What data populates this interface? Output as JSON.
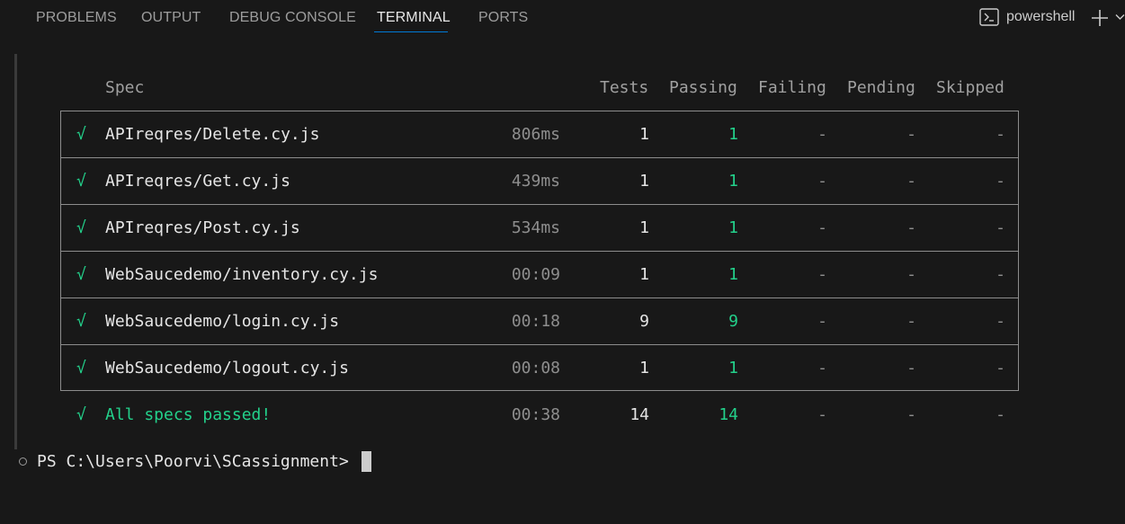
{
  "tabs": [
    {
      "label": "PROBLEMS",
      "active": false
    },
    {
      "label": "OUTPUT",
      "active": false
    },
    {
      "label": "DEBUG CONSOLE",
      "active": false
    },
    {
      "label": "TERMINAL",
      "active": true
    },
    {
      "label": "PORTS",
      "active": false
    }
  ],
  "shell": {
    "label": "powershell",
    "icon": "terminal-icon",
    "add_icon": "plus-icon",
    "dropdown_icon": "chevron-down-icon"
  },
  "headers": {
    "spec": "Spec",
    "tests": "Tests",
    "passing": "Passing",
    "failing": "Failing",
    "pending": "Pending",
    "skipped": "Skipped"
  },
  "rows": [
    {
      "check": "√",
      "spec": "APIreqres/Delete.cy.js",
      "duration": "806ms",
      "tests": "1",
      "passing": "1",
      "failing": "-",
      "pending": "-",
      "skipped": "-"
    },
    {
      "check": "√",
      "spec": "APIreqres/Get.cy.js",
      "duration": "439ms",
      "tests": "1",
      "passing": "1",
      "failing": "-",
      "pending": "-",
      "skipped": "-"
    },
    {
      "check": "√",
      "spec": "APIreqres/Post.cy.js",
      "duration": "534ms",
      "tests": "1",
      "passing": "1",
      "failing": "-",
      "pending": "-",
      "skipped": "-"
    },
    {
      "check": "√",
      "spec": "WebSaucedemo/inventory.cy.js",
      "duration": "00:09",
      "tests": "1",
      "passing": "1",
      "failing": "-",
      "pending": "-",
      "skipped": "-"
    },
    {
      "check": "√",
      "spec": "WebSaucedemo/login.cy.js",
      "duration": "00:18",
      "tests": "9",
      "passing": "9",
      "failing": "-",
      "pending": "-",
      "skipped": "-"
    },
    {
      "check": "√",
      "spec": "WebSaucedemo/logout.cy.js",
      "duration": "00:08",
      "tests": "1",
      "passing": "1",
      "failing": "-",
      "pending": "-",
      "skipped": "-"
    }
  ],
  "summary": {
    "check": "√",
    "label": "All specs passed!",
    "duration": "00:38",
    "tests": "14",
    "passing": "14",
    "failing": "-",
    "pending": "-",
    "skipped": "-"
  },
  "prompt": "PS C:\\Users\\Poorvi\\SCassignment>",
  "colors": {
    "background": "#181818",
    "pass_green": "#23d18b",
    "tab_active_underline": "#0078d4",
    "table_border": "#8c8c8c"
  }
}
